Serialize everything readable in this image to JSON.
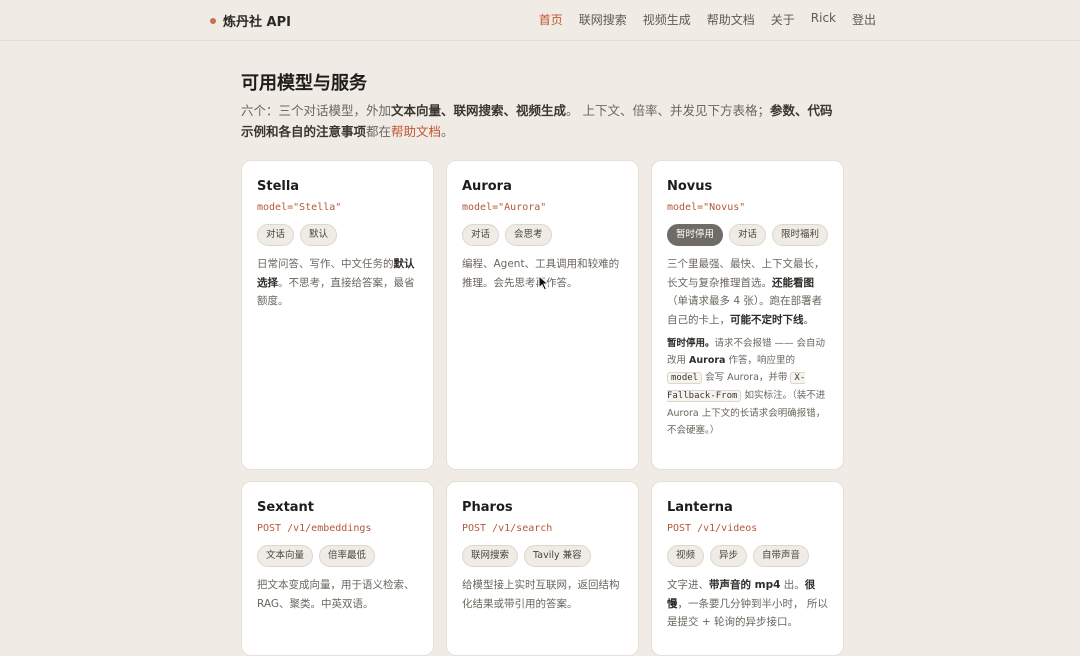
{
  "header": {
    "brand": "炼丹社 API",
    "nav": [
      {
        "label": "首页",
        "active": true
      },
      {
        "label": "联网搜索",
        "active": false
      },
      {
        "label": "视频生成",
        "active": false
      },
      {
        "label": "帮助文档",
        "active": false
      },
      {
        "label": "关于",
        "active": false
      },
      {
        "label": "Rick",
        "active": false
      },
      {
        "label": "登出",
        "active": false
      }
    ]
  },
  "main": {
    "title": "可用模型与服务",
    "intro": {
      "p1": "六个：三个对话模型，外加",
      "b1": "文本向量、联网搜索、视频生成",
      "p2": "。 上下文、倍率、并发见下方表格；",
      "b2": "参数、代码示例和各自的注意事项",
      "p3": "都在",
      "link": "帮助文档",
      "p4": "。"
    }
  },
  "cards": {
    "stella": {
      "name": "Stella",
      "code": "model=\"Stella\"",
      "tags": [
        "对话",
        "默认"
      ],
      "desc_a": "日常问答、写作、中文任务的",
      "desc_b": "默认选择",
      "desc_c": "。不思考，直接给答案，最省额度。"
    },
    "aurora": {
      "name": "Aurora",
      "code": "model=\"Aurora\"",
      "tags": [
        "对话",
        "会思考"
      ],
      "desc": "编程、Agent、工具调用和较难的推理。会先思考再作答。"
    },
    "novus": {
      "name": "Novus",
      "code": "model=\"Novus\"",
      "tags": [
        "暂时停用",
        "对话",
        "限时福利"
      ],
      "desc_a": "三个里最强、最快、上下文最长，长文与复杂推理首选。",
      "desc_b": "还能看图",
      "desc_c": "（单请求最多 4 张）。跑在部署者自己的卡上，",
      "desc_d": "可能不定时下线",
      "desc_e": "。",
      "note_a": "暂时停用。",
      "note_b": "请求不会报错 —— 会自动改用 ",
      "note_c": "Aurora",
      "note_d": " 作答，响应里的 ",
      "note_code1": "model",
      "note_e": " 会写 Aurora，并带 ",
      "note_code2": "X-Fallback-From",
      "note_f": " 如实标注。（装不进 Aurora 上下文的长请求会明确报错，不会硬塞。）"
    },
    "sextant": {
      "name": "Sextant",
      "code": "POST /v1/embeddings",
      "tags": [
        "文本向量",
        "倍率最低"
      ],
      "desc": "把文本变成向量，用于语义检索、RAG、聚类。中英双语。"
    },
    "pharos": {
      "name": "Pharos",
      "code": "POST /v1/search",
      "tags": [
        "联网搜索",
        "Tavily 兼容"
      ],
      "desc": "给模型接上实时互联网，返回结构化结果或带引用的答案。"
    },
    "lanterna": {
      "name": "Lanterna",
      "code": "POST /v1/videos",
      "tags": [
        "视频",
        "异步",
        "自带声音"
      ],
      "desc_a": "文字进、",
      "desc_b": "带声音的 mp4",
      "desc_c": " 出。",
      "desc_d": "很慢",
      "desc_e": "，一条要几分钟到半小时， 所以是提交 + 轮询的异步接口。"
    }
  },
  "colors": {
    "accent": "#c0552f",
    "background": "#f0ece5",
    "card": "#ffffff"
  }
}
